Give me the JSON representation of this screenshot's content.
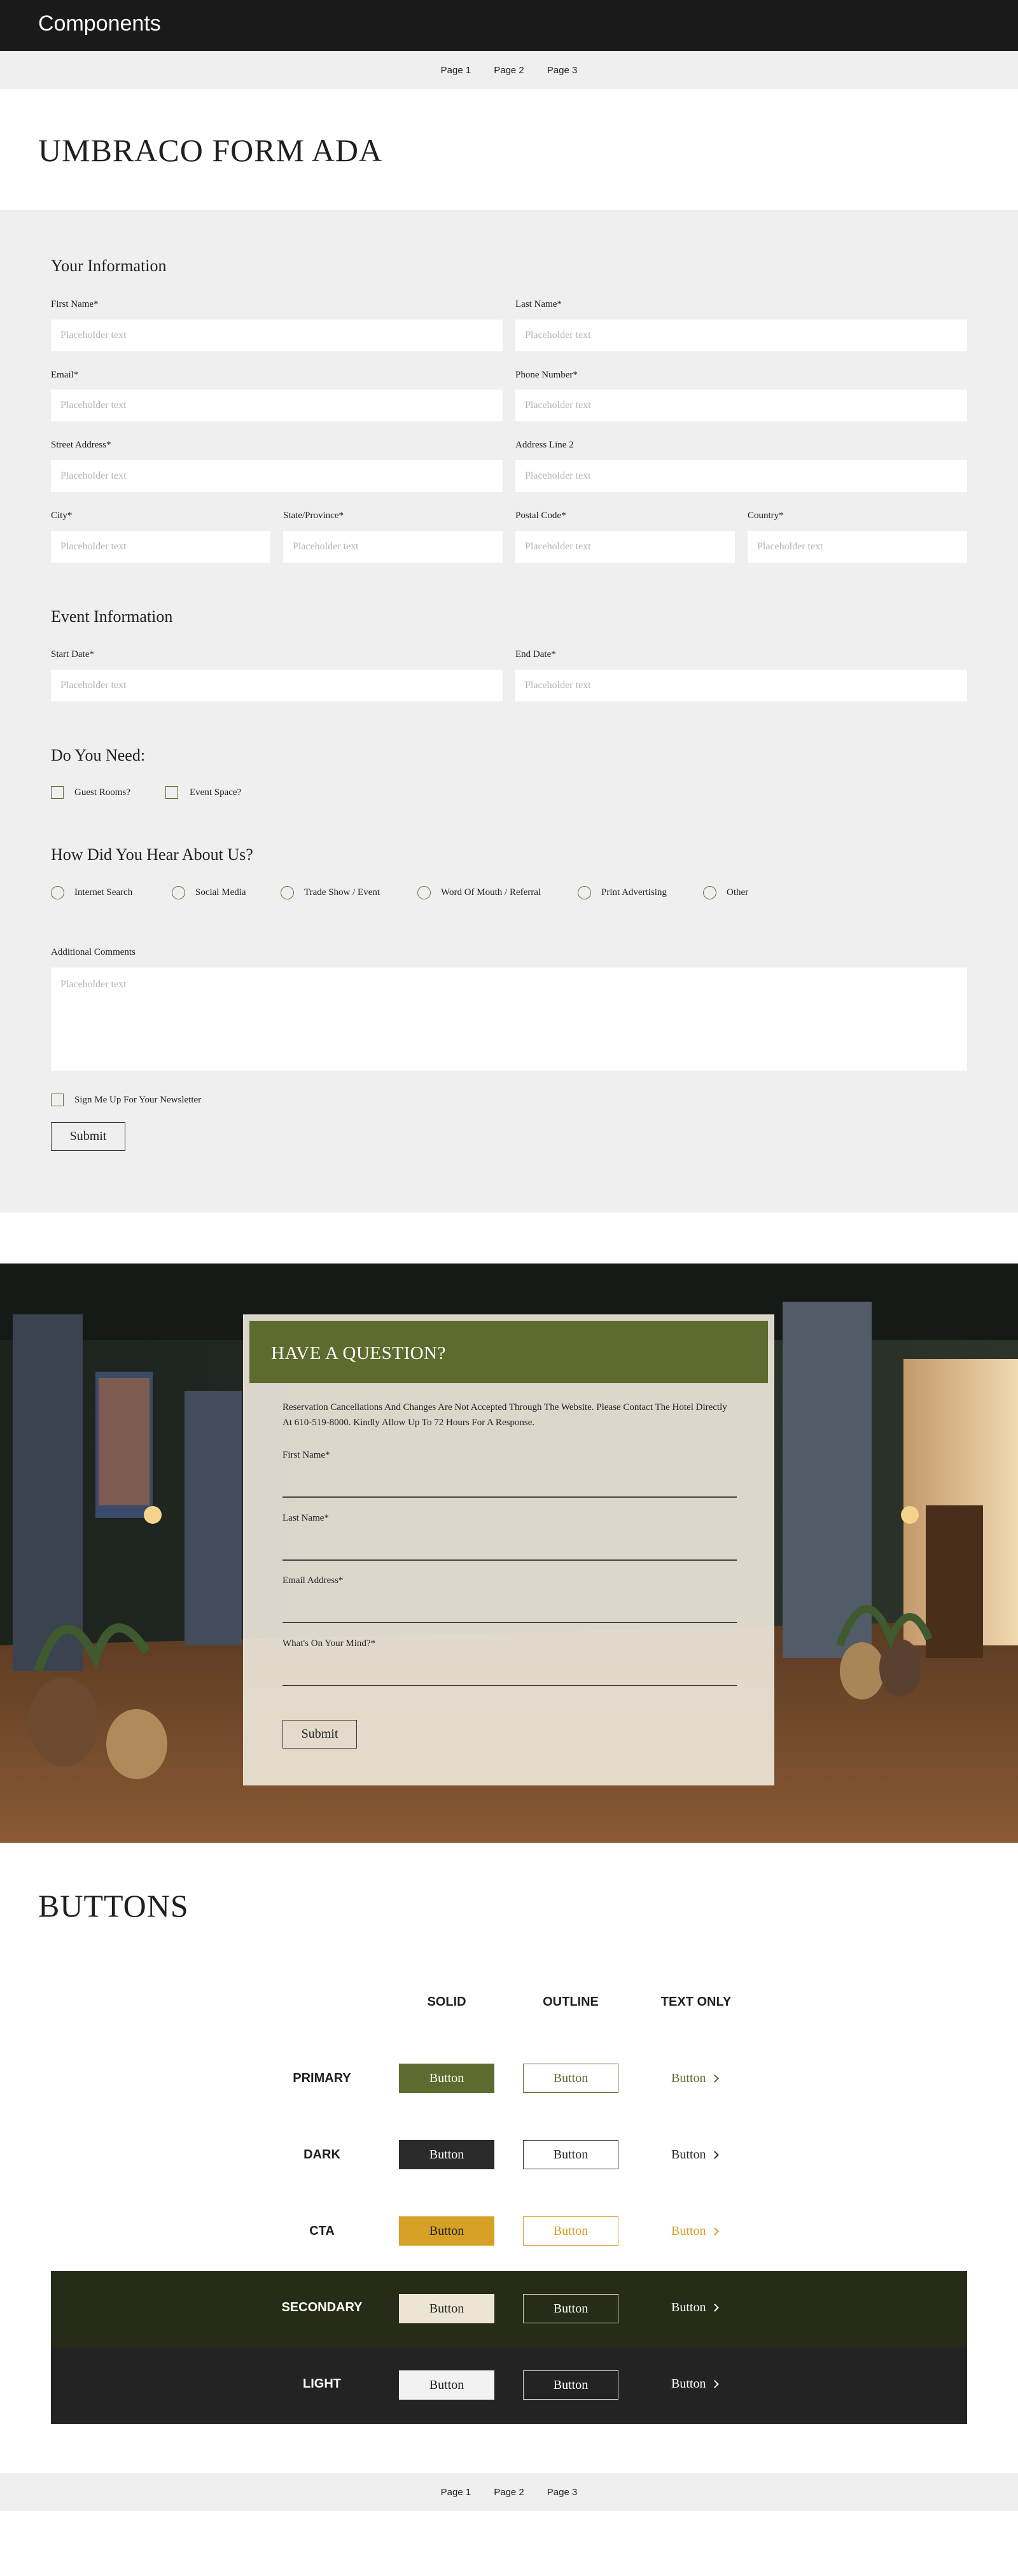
{
  "header": {
    "title": "Components"
  },
  "page_nav": {
    "items": [
      "Page 1",
      "Page 2",
      "Page 3"
    ]
  },
  "hero": {
    "title": "UMBRACO FORM ADA"
  },
  "form": {
    "placeholder": "Placeholder text",
    "your_info_title": "Your  Information",
    "first_name": "First Name*",
    "last_name": "Last Name*",
    "email": "Email*",
    "phone": "Phone Number*",
    "street": "Street Address*",
    "address2": "Address Line 2",
    "city": "City*",
    "state": "State/Province*",
    "postal": "Postal Code*",
    "country": "Country*",
    "event_title": "Event Information",
    "start_date": "Start Date*",
    "end_date": "End Date*",
    "need_title": "Do You Need:",
    "need_options": [
      "Guest Rooms?",
      "Event Space?"
    ],
    "hear_title": "How Did You Hear About Us?",
    "hear_options": [
      "Internet Search",
      "Social Media",
      "Trade Show / Event",
      "Word Of Mouth / Referral",
      "Print Advertising",
      "Other"
    ],
    "comments": "Additional Comments",
    "newsletter": "Sign Me Up For Your Newsletter",
    "submit": "Submit"
  },
  "question_card": {
    "title": "HAVE A QUESTION?",
    "description": "Reservation Cancellations And Changes Are Not Accepted Through The Website. Please Contact The Hotel Directly At 610-519-8000. Kindly Allow Up To 72 Hours For A Response.",
    "first_name": "First Name*",
    "last_name": "Last Name*",
    "email": "Email Address*",
    "mind": "What's On Your Mind?*",
    "submit": "Submit"
  },
  "buttons_section": {
    "title": "BUTTONS",
    "columns": [
      "SOLID",
      "OUTLINE",
      "TEXT ONLY"
    ],
    "rows": [
      {
        "name": "PRIMARY",
        "label": "Button"
      },
      {
        "name": "DARK",
        "label": "Button"
      },
      {
        "name": "CTA",
        "label": "Button"
      },
      {
        "name": "SECONDARY",
        "label": "Button"
      },
      {
        "name": "LIGHT",
        "label": "Button"
      }
    ]
  },
  "colors": {
    "olive": "#5e6b2e",
    "dark": "#2b2b2b",
    "gold": "#d6a124",
    "secondary_bg": "#262c17",
    "light_bg": "#232323"
  }
}
